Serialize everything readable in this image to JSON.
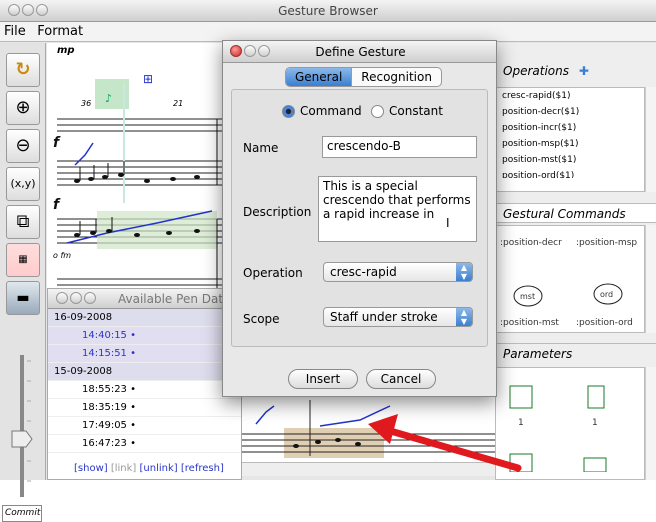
{
  "main_window": {
    "title": "Gesture Browser"
  },
  "menu": {
    "file": "File",
    "format": "Format"
  },
  "toolbar": {
    "coord_label": "(x,y)",
    "commit_label": "Commit"
  },
  "score": {
    "dynamic_mp": "mp",
    "dynamic_fm": "o fm",
    "measure_36": "36",
    "measure_21": "21"
  },
  "dialog": {
    "title": "Define Gesture",
    "tabs": [
      "General",
      "Recognition"
    ],
    "command_label": "Command",
    "constant_label": "Constant",
    "name_label": "Name",
    "name_value": "crescendo-B",
    "description_label": "Description",
    "description_value": "This is a special crescendo that performs a rapid increase in",
    "operation_label": "Operation",
    "operation_value": "cresc-rapid",
    "scope_label": "Scope",
    "scope_value": "Staff under stroke",
    "insert_label": "Insert",
    "cancel_label": "Cancel"
  },
  "operations_panel": {
    "title": "Operations",
    "items": [
      "cresc-rapid($1)",
      "position-decr($1)",
      "position-incr($1)",
      "position-msp($1)",
      "position-mst($1)",
      "position-ord($1)"
    ]
  },
  "gestural_commands_panel": {
    "title": "Gestural Commands",
    "items": [
      ":position-decr",
      ":position-msp",
      ":position-mst",
      ":position-ord"
    ],
    "glyphs": [
      "mst",
      "ord"
    ]
  },
  "parameters_panel": {
    "title": "Parameters",
    "items": [
      "1",
      "1"
    ]
  },
  "pen_data": {
    "title": "Available Pen Dat",
    "rows": [
      {
        "type": "date",
        "text": "16-09-2008"
      },
      {
        "type": "sel",
        "text": "14:40:15 •"
      },
      {
        "type": "sel",
        "text": "14:15:51 •"
      },
      {
        "type": "date",
        "text": "15-09-2008"
      },
      {
        "type": "time",
        "text": "18:55:23 •"
      },
      {
        "type": "time",
        "text": "18:35:19 •"
      },
      {
        "type": "time",
        "text": "17:49:05 •"
      },
      {
        "type": "time",
        "text": "16:47:23 •"
      }
    ],
    "links": {
      "show": "[show]",
      "link": "[link]",
      "unlink": "[unlink]",
      "refresh": "[refresh]"
    }
  },
  "colors": {
    "accent": "#3b7fd0",
    "arrow": "#e0191e",
    "link": "#2a36c9",
    "highlight": "#9fd5a4"
  }
}
